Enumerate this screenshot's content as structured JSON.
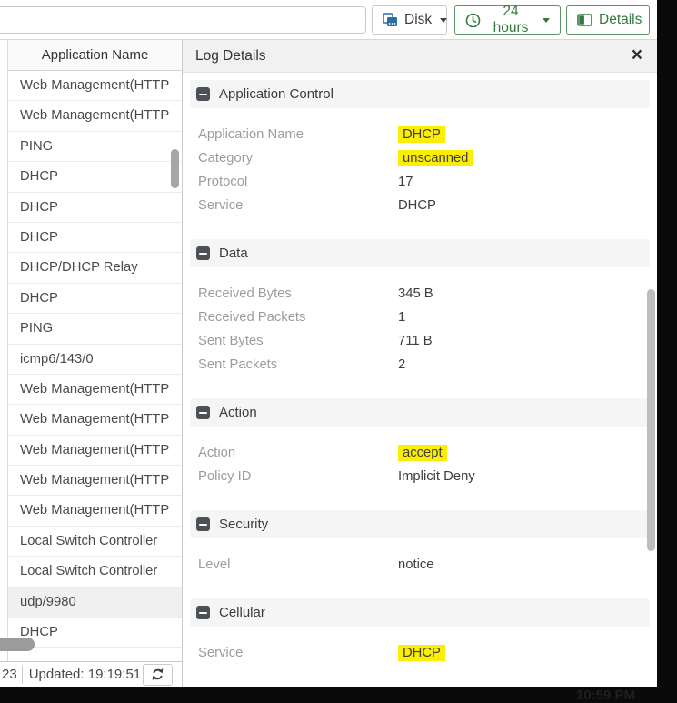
{
  "topbar": {
    "search_value": "",
    "buttons": [
      {
        "label": "Disk",
        "icon": "disk-icon",
        "style": "neutral",
        "has_caret": true
      },
      {
        "label": "24 hours",
        "icon": "clock-icon",
        "style": "green",
        "has_caret": true
      },
      {
        "label": "Details",
        "icon": "table-columns-icon",
        "style": "green",
        "has_caret": false
      }
    ]
  },
  "list_panel": {
    "header": "Application Name",
    "rows": [
      "Web Management(HTTP",
      "Web Management(HTTP",
      "PING",
      "DHCP",
      "DHCP",
      "DHCP",
      "DHCP/DHCP Relay",
      "DHCP",
      "PING",
      "icmp6/143/0",
      "Web Management(HTTP",
      "Web Management(HTTP",
      "Web Management(HTTP",
      "Web Management(HTTP",
      "Web Management(HTTP",
      "Local Switch Controller",
      "Local Switch Controller",
      "udp/9980",
      "DHCP"
    ],
    "selected_index": 17,
    "footer": {
      "left_fragment": "23",
      "updated_label": "Updated: 19:19:51"
    }
  },
  "log_panel": {
    "title": "Log Details",
    "close_glyph": "×",
    "sections": [
      {
        "title": "Application Control",
        "rows": [
          {
            "label": "Application Name",
            "value": "DHCP",
            "highlight": true
          },
          {
            "label": "Category",
            "value": "unscanned",
            "highlight": true
          },
          {
            "label": "Protocol",
            "value": "17",
            "highlight": false
          },
          {
            "label": "Service",
            "value": "DHCP",
            "highlight": false
          }
        ]
      },
      {
        "title": "Data",
        "rows": [
          {
            "label": "Received Bytes",
            "value": "345 B",
            "highlight": false
          },
          {
            "label": "Received Packets",
            "value": "1",
            "highlight": false
          },
          {
            "label": "Sent Bytes",
            "value": "711 B",
            "highlight": false
          },
          {
            "label": "Sent Packets",
            "value": "2",
            "highlight": false
          }
        ]
      },
      {
        "title": "Action",
        "rows": [
          {
            "label": "Action",
            "value": "accept",
            "highlight": true
          },
          {
            "label": "Policy ID",
            "value": "Implicit Deny",
            "highlight": false
          }
        ]
      },
      {
        "title": "Security",
        "rows": [
          {
            "label": "Level",
            "value": "notice",
            "highlight": false
          }
        ]
      },
      {
        "title": "Cellular",
        "rows": [
          {
            "label": "Service",
            "value": "DHCP",
            "highlight": true
          }
        ]
      }
    ]
  },
  "colors": {
    "accent_green": "#347a40",
    "accent_blue": "#2e6da4",
    "highlight_yellow": "#fbee00"
  },
  "overlay_clock": "10:59 PM"
}
